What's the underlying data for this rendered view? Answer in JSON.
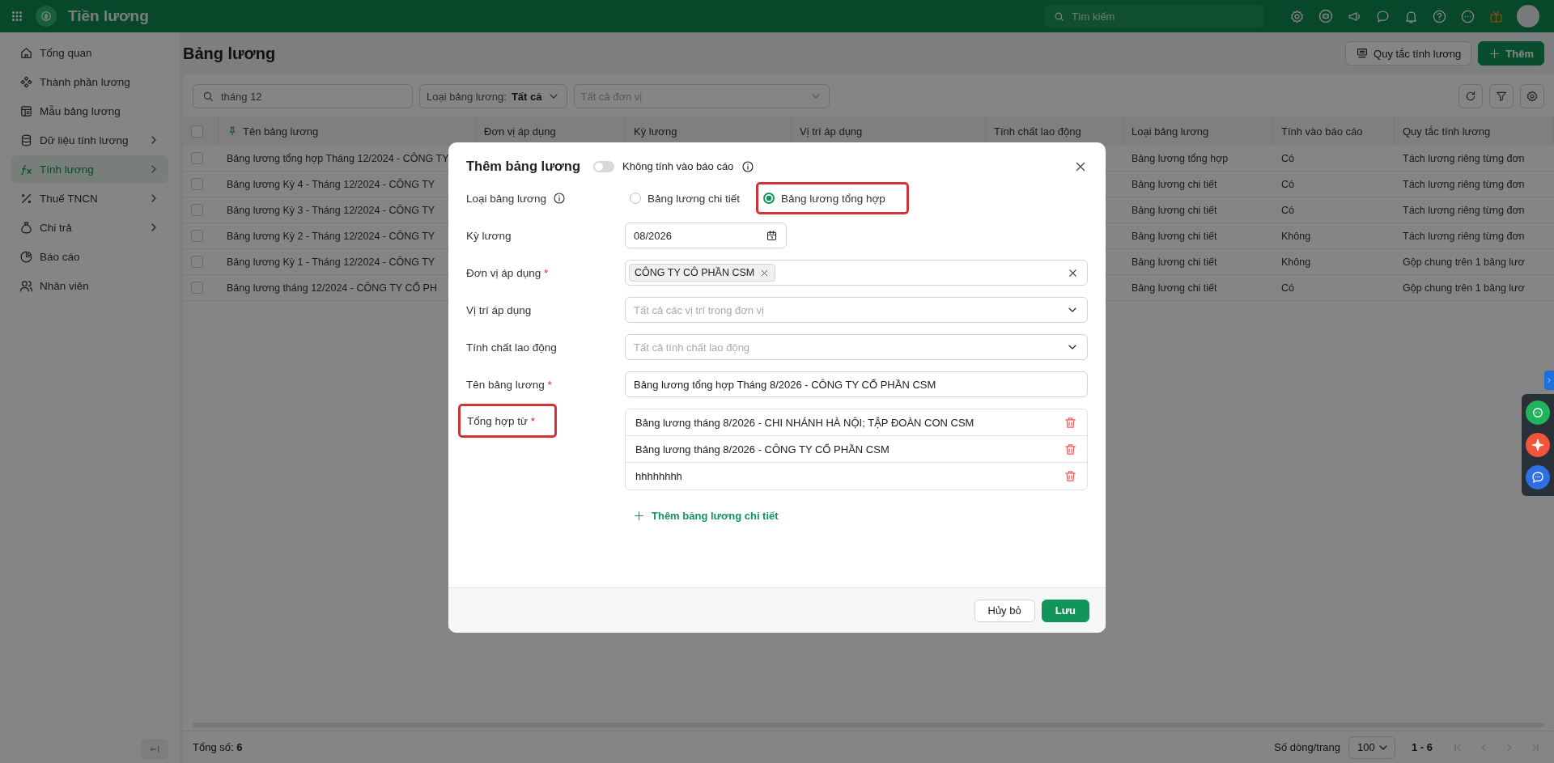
{
  "app": {
    "title": "Tiền lương",
    "search_placeholder": "Tìm kiếm"
  },
  "sidebar": {
    "items": [
      {
        "label": "Tổng quan",
        "has_children": false,
        "selected": false
      },
      {
        "label": "Thành phần lương",
        "has_children": false,
        "selected": false
      },
      {
        "label": "Mẫu bảng lương",
        "has_children": false,
        "selected": false
      },
      {
        "label": "Dữ liệu tính lương",
        "has_children": true,
        "selected": false
      },
      {
        "label": "Tính lương",
        "has_children": true,
        "selected": true
      },
      {
        "label": "Thuế TNCN",
        "has_children": true,
        "selected": false
      },
      {
        "label": "Chi trả",
        "has_children": true,
        "selected": false
      },
      {
        "label": "Báo cáo",
        "has_children": false,
        "selected": false
      },
      {
        "label": "Nhân viên",
        "has_children": false,
        "selected": false
      }
    ]
  },
  "page": {
    "title": "Bảng lương",
    "buttons": [
      {
        "label": "Quy tắc tính lương",
        "kind": "outline"
      },
      {
        "label": "Thêm",
        "kind": "primary"
      }
    ]
  },
  "filters": {
    "search_value": "tháng 12",
    "type_filter": {
      "label": "Loại bảng lương:",
      "value": "Tất cả"
    },
    "unit_filter": {
      "placeholder": "Tất cả đơn vị"
    }
  },
  "table": {
    "select_all_checked": false,
    "columns": [
      "Tên bảng lương",
      "Đơn vị áp dụng",
      "Kỳ lương",
      "Vị trí áp dụng",
      "Tính chất lao động",
      "Loại bảng lương",
      "Tính vào báo cáo",
      "Quy tắc tính lương"
    ],
    "rows": [
      {
        "checked": false,
        "name": "Bảng lương tổng hợp Tháng 12/2024 - CÔNG TY",
        "type": "Bảng lương tổng hợp",
        "in_report": "Có",
        "rule": "Tách lương riêng từng đơn"
      },
      {
        "checked": false,
        "name": "Bảng lương Kỳ 4 - Tháng 12/2024 - CÔNG TY",
        "type": "Bảng lương chi tiết",
        "in_report": "Có",
        "rule": "Tách lương riêng từng đơn"
      },
      {
        "checked": false,
        "name": "Bảng lương Kỳ 3 - Tháng 12/2024 - CÔNG TY",
        "type": "Bảng lương chi tiết",
        "in_report": "Có",
        "rule": "Tách lương riêng từng đơn"
      },
      {
        "checked": false,
        "name": "Bảng lương Kỳ 2 - Tháng 12/2024 - CÔNG TY",
        "type": "Bảng lương chi tiết",
        "in_report": "Không",
        "rule": "Tách lương riêng từng đơn"
      },
      {
        "checked": false,
        "name": "Bảng lương Kỳ 1 - Tháng 12/2024 - CÔNG TY",
        "type": "Bảng lương chi tiết",
        "in_report": "Không",
        "rule": "Gộp chung trên 1 bảng lươ"
      },
      {
        "checked": false,
        "name": "Bảng lương tháng 12/2024 - CÔNG TY CỔ PH",
        "type": "Bảng lương chi tiết",
        "in_report": "Có",
        "rule": "Gộp chung trên 1 bảng lươ"
      }
    ]
  },
  "footer": {
    "total_label": "Tổng số:",
    "total": "6",
    "page_size_label": "Số dòng/trang",
    "page_size": "100",
    "range": "1 - 6"
  },
  "modal": {
    "title": "Thêm bảng lương",
    "toggle": {
      "label": "Không tính vào báo cáo",
      "on": false
    },
    "fields": [
      {
        "kind": "radio",
        "label": "Loại bảng lương",
        "highlighted": false,
        "options": [
          {
            "label": "Bảng lương chi tiết",
            "selected": false,
            "highlighted": false
          },
          {
            "label": "Bảng lương tổng hợp",
            "selected": true,
            "highlighted": true
          }
        ]
      },
      {
        "kind": "date",
        "label": "Kỳ lương",
        "highlighted": false,
        "value": "08/2026"
      },
      {
        "kind": "tags",
        "label": "Đơn vị áp dụng",
        "required_mark": "*",
        "highlighted": false,
        "tags": [
          "CÔNG TY CÔ PHẦN CSM"
        ]
      },
      {
        "kind": "select",
        "label": "Vị trí áp dụng",
        "highlighted": false,
        "placeholder": "Tất cả các vị trí trong đơn vị"
      },
      {
        "kind": "select",
        "label": "Tính chất lao động",
        "highlighted": false,
        "placeholder": "Tất cả tính chất lao động"
      },
      {
        "kind": "text",
        "label": "Tên bảng lương",
        "required_mark": "*",
        "highlighted": false,
        "value": "Bảng lương tổng hợp Tháng 8/2026  - CÔNG TY CỔ PHẦN CSM"
      },
      {
        "kind": "list",
        "label": "Tổng hợp từ",
        "required_mark": "*",
        "highlighted": true,
        "items": [
          "Bảng lương tháng 8/2026  - CHI NHÁNH HÀ NỘI; TẬP ĐOÀN CON CSM",
          "Bảng lương tháng 8/2026  - CÔNG TY CỔ PHẦN CSM",
          "hhhhhhhh"
        ],
        "add_label": "Thêm bảng lương chi tiết"
      }
    ],
    "buttons": [
      {
        "label": "Hủy bỏ",
        "kind": "outline"
      },
      {
        "label": "Lưu",
        "kind": "primary"
      }
    ]
  }
}
